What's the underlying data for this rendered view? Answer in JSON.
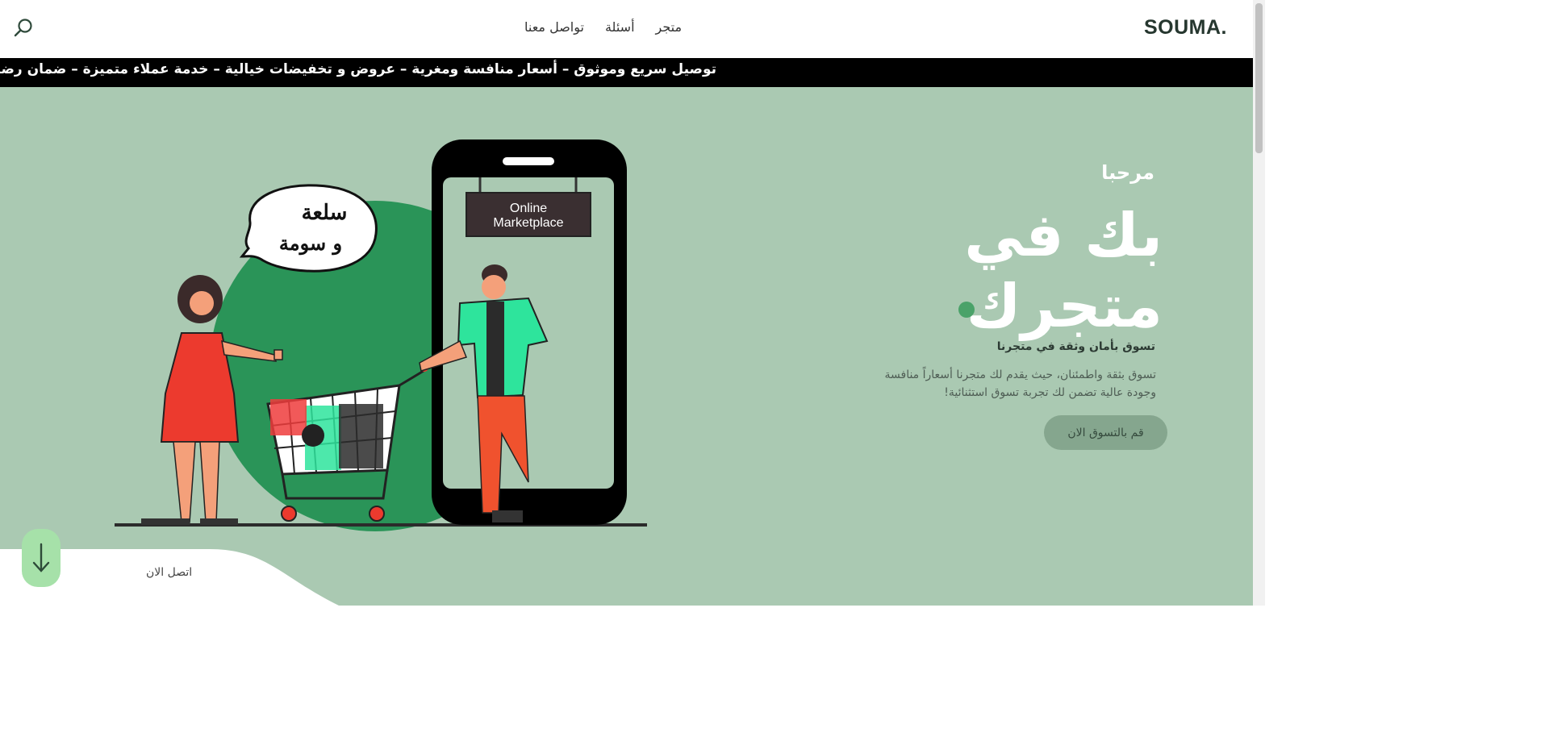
{
  "header": {
    "brand": "SOUMA.",
    "nav": [
      "متجر",
      "أسئلة",
      "تواصل معنا"
    ]
  },
  "ticker": {
    "text": "توصيل سريع وموثوق – أسعار منافسة ومغرية – عروض و تخفيضات خيالية – خدمة عملاء متميزة – ضمان رضا العميل – تس"
  },
  "hero": {
    "greeting": "مرحبا",
    "title_line1": "بك في",
    "title_line2": "متجرك",
    "subtitle": "تسوق بأمان وثقة في متجرنا",
    "description": "تسوق بثقة واطمئنان، حيث يقدم لك متجرنا أسعاراً منافسة وجودة عالية تضمن لك تجربة تسوق استثنائية!",
    "cta_label": "قم بالتسوق الان"
  },
  "illustration": {
    "speech_line1": "سلعة",
    "speech_line2": "و سومة",
    "sign_line1": "Online",
    "sign_line2": "Marketplace"
  },
  "footer": {
    "contact_label": "اتصل الان"
  },
  "colors": {
    "hero_bg": "#aac9b2",
    "accent": "#4aa269",
    "cta_bg": "#85a68e",
    "ticker_bg": "#000000"
  }
}
